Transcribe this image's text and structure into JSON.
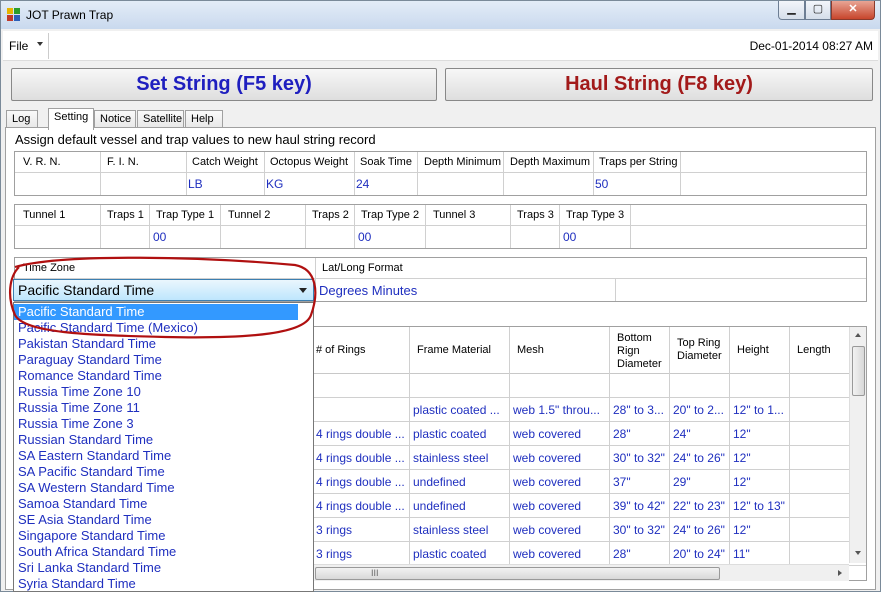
{
  "window": {
    "title": "JOT Prawn Trap"
  },
  "menu": {
    "file_label": "File",
    "datetime": "Dec-01-2014 08:27 AM"
  },
  "buttons": {
    "set_string": "Set String  (F5 key)",
    "haul_string": "Haul String  (F8 key)"
  },
  "tabs": [
    "Log",
    "Setting",
    "Notice",
    "Satellite",
    "Help"
  ],
  "active_tab": "Setting",
  "description": "Assign default vessel and trap values to new haul string record",
  "vessel_grid": {
    "headers": [
      "V. R. N.",
      "F. I. N.",
      "Catch Weight",
      "Octopus Weight",
      "Soak Time",
      "Depth Minimum",
      "Depth Maximum",
      "Traps per String"
    ],
    "values": [
      "",
      "",
      "LB",
      "KG",
      "24",
      "",
      "",
      "50"
    ]
  },
  "trap_grid": {
    "headers": [
      "Tunnel 1",
      "Traps 1",
      "Trap Type 1",
      "Tunnel 2",
      "Traps 2",
      "Trap Type 2",
      "Tunnel 3",
      "Traps 3",
      "Trap Type 3"
    ],
    "values": [
      "",
      "",
      "00",
      "",
      "",
      "00",
      "",
      "",
      "00"
    ]
  },
  "format_grid": {
    "headers": [
      "Time Zone",
      "Lat/Long Format"
    ],
    "lat_long_value": "Degrees Minutes"
  },
  "timezone": {
    "selected": "Pacific Standard Time",
    "options": [
      "Pacific Standard Time",
      "Pacific Standard Time (Mexico)",
      "Pakistan Standard Time",
      "Paraguay Standard Time",
      "Romance Standard Time",
      "Russia Time Zone 10",
      "Russia Time Zone 11",
      "Russia Time Zone 3",
      "Russian Standard Time",
      "SA Eastern Standard Time",
      "SA Pacific Standard Time",
      "SA Western Standard Time",
      "Samoa Standard Time",
      "SE Asia Standard Time",
      "Singapore Standard Time",
      "South Africa Standard Time",
      "Sri Lanka Standard Time",
      "Syria Standard Time"
    ]
  },
  "trap_types": {
    "headers": [
      "# of Rings",
      "Frame Material",
      "Mesh",
      "Bottom Rign Diameter",
      "Top Ring Diameter",
      "Height",
      "Length"
    ],
    "rows": [
      [
        "",
        "",
        "",
        "",
        "",
        "",
        ""
      ],
      [
        "",
        "plastic coated ...",
        "web 1.5\" throu...",
        "28\" to 3...",
        "20\" to 2...",
        "12\" to 1...",
        ""
      ],
      [
        "4 rings double ...",
        "plastic coated",
        "web covered",
        "28\"",
        "24\"",
        "12\"",
        ""
      ],
      [
        "4 rings double ...",
        "stainless steel",
        "web covered",
        "30\" to 32\"",
        "24\" to 26\"",
        "12\"",
        ""
      ],
      [
        "4 rings double ...",
        "undefined",
        "web covered",
        "37\"",
        "29\"",
        "12\"",
        ""
      ],
      [
        "4 rings double ...",
        "undefined",
        "web covered",
        "39\" to 42\"",
        "22\" to 23\"",
        "12\" to 13\"",
        ""
      ],
      [
        "3 rings",
        "stainless steel",
        "web covered",
        "30\" to 32\"",
        "24\" to 26\"",
        "12\"",
        ""
      ],
      [
        "3 rings",
        "plastic coated",
        "web covered",
        "28\"",
        "20\" to 24\"",
        "11\"",
        ""
      ]
    ]
  },
  "scroll": {
    "h_thumb_grip": "III"
  },
  "colors": {
    "set_button_text": "#1f1fbf",
    "haul_button_text": "#a21a1a",
    "value_text": "#1f2fbf",
    "selection": "#3399ff",
    "annotation_circle": "#b01010"
  }
}
